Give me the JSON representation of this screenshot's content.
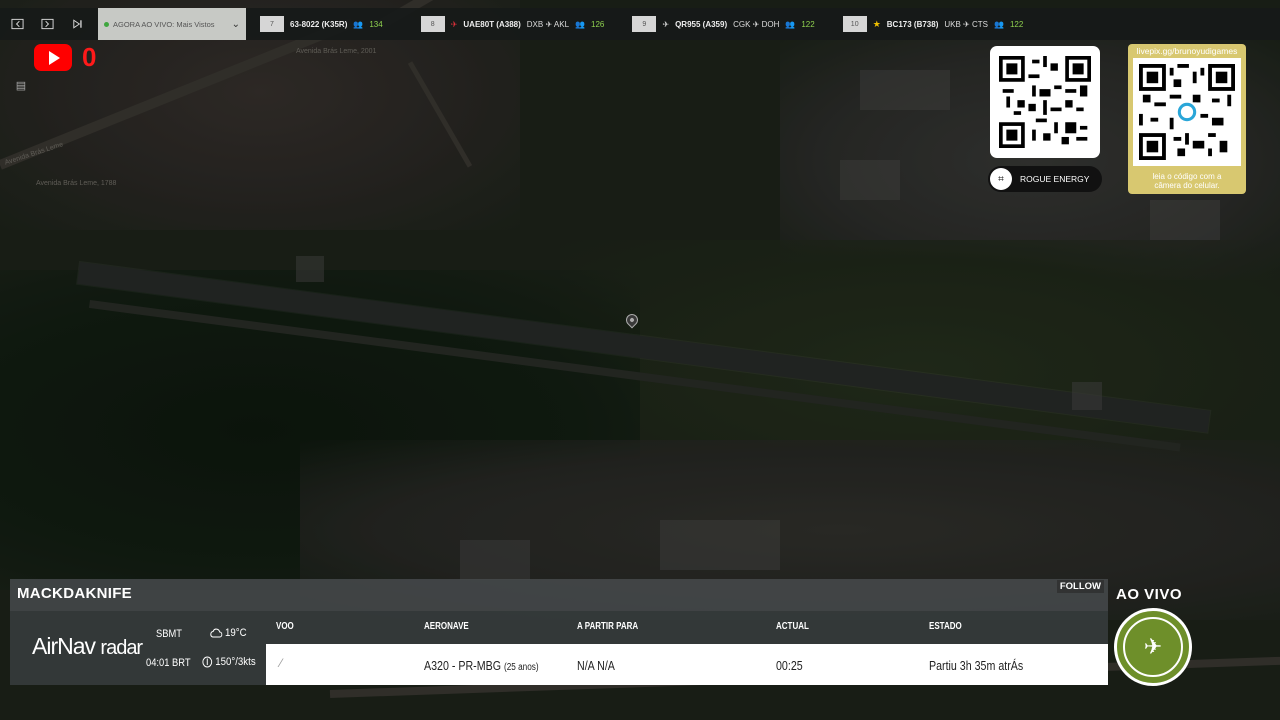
{
  "topbar": {
    "live_dropdown": "AGORA AO VIVO: Mais Vistos",
    "tickers": [
      {
        "rank": "7",
        "flight": "63-8022 (K35R)",
        "route": "",
        "count": "134",
        "marker": "none"
      },
      {
        "rank": "8",
        "flight": "UAE80T (A388)",
        "route": "DXB ✈ AKL",
        "count": "126",
        "marker": "red-plane"
      },
      {
        "rank": "9",
        "flight": "QR955 (A359)",
        "route": "CGK ✈ DOH",
        "count": "122",
        "marker": "white-plane"
      },
      {
        "rank": "10",
        "flight": "BC173 (B738)",
        "route": "UKB ✈ CTS",
        "count": "122",
        "marker": "star"
      }
    ]
  },
  "youtube": {
    "count": "0"
  },
  "qr_sponsor": {
    "label": "ROGUE ENERGY"
  },
  "qr_livepix": {
    "url": "livepix.gg/brunoyudigames",
    "caption_line1": "leia o código com a",
    "caption_line2": "câmera do celular."
  },
  "map_labels": [
    {
      "text": "Avenida Brás Leme, 2001"
    },
    {
      "text": "Avenida Brás Leme"
    },
    {
      "text": "Avenida Brás Leme, 1788"
    }
  ],
  "panel": {
    "username": "MACKDAKNIFE",
    "follow": "FOLLOW",
    "brand_main": "AirNav",
    "brand_sub": "radar",
    "icao": "SBMT",
    "local_time": "04:01 BRT",
    "temperature": "19°C",
    "wind": "150°/3kts",
    "headers": {
      "flight": "VOO",
      "aircraft": "AERONAVE",
      "departing": "A PARTIR PARA",
      "actual": "ACTUAL",
      "status": "ESTADO"
    },
    "row": {
      "aircraft": "A320 - PR-MBG",
      "aircraft_age": "(25 anos)",
      "departing": "N/A N/A",
      "actual": "00:25",
      "status": "Partiu 3h 35m atrÁs"
    }
  },
  "live_badge": {
    "label": "AO VIVO"
  },
  "colors": {
    "ticker_count": "#8fd14f",
    "youtube_red": "#ff0000",
    "panel_bg": "#373c3e",
    "row_bg": "#ffffff",
    "badge_green": "#6e8f2a"
  }
}
